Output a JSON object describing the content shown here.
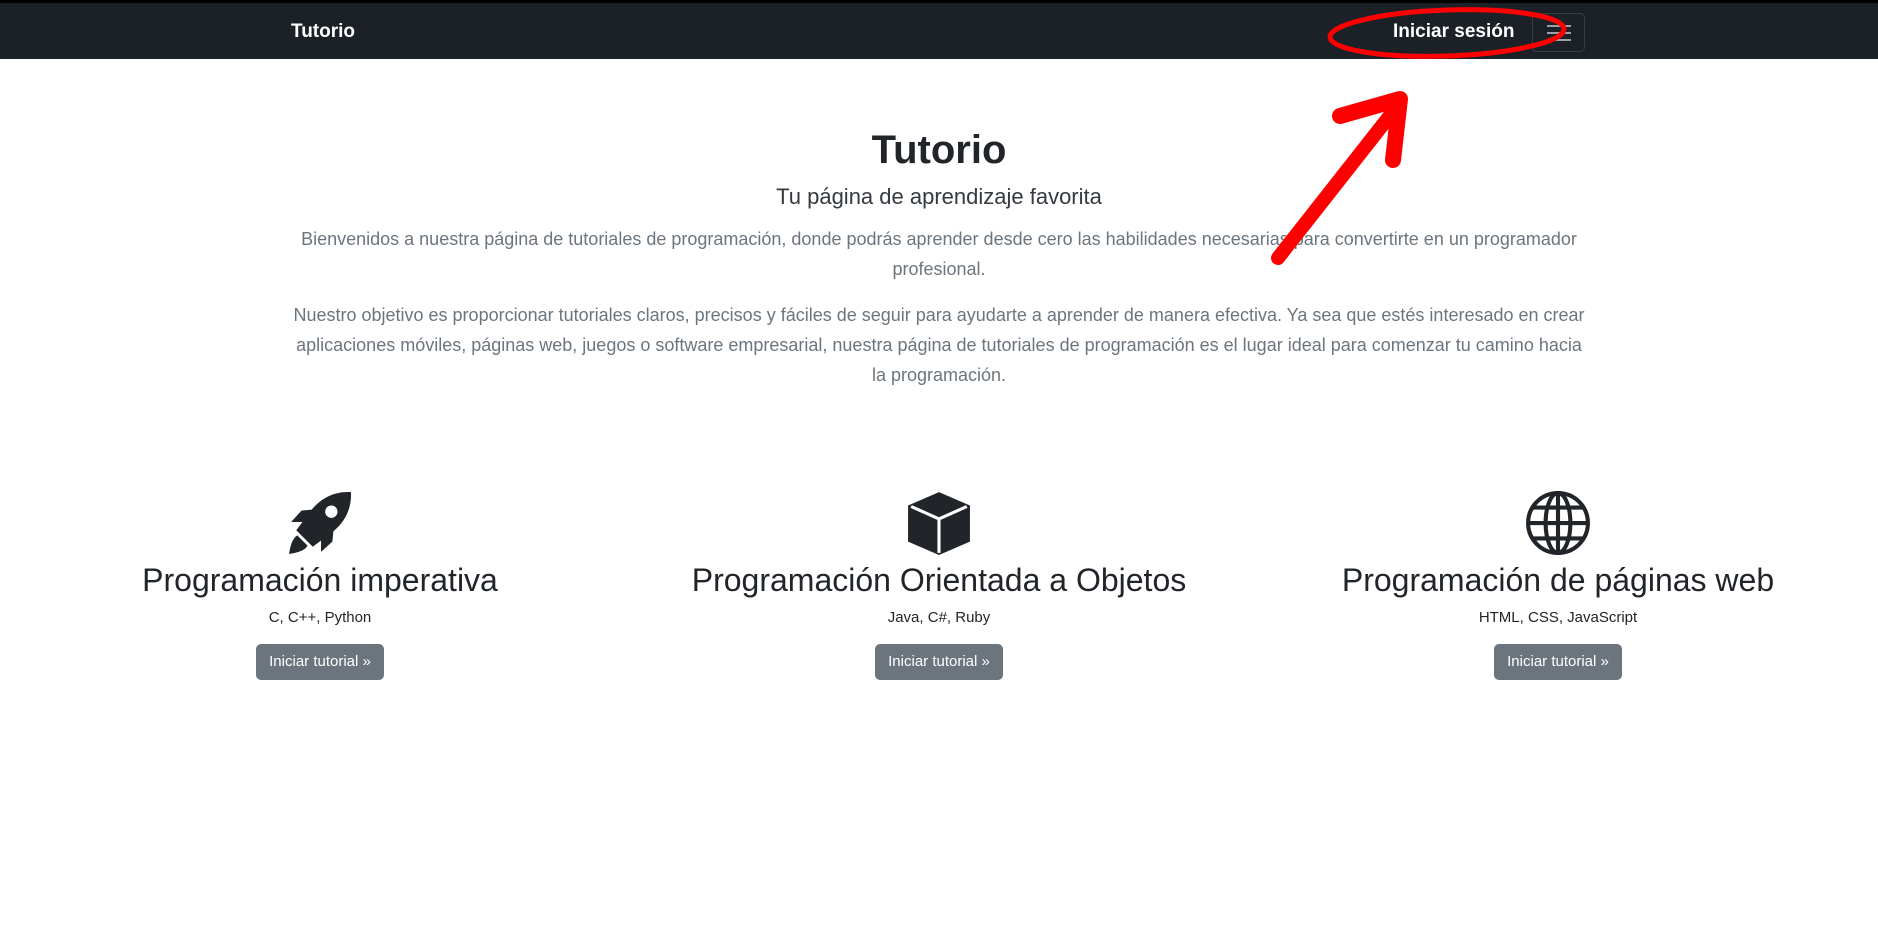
{
  "navbar": {
    "brand": "Tutorio",
    "login_label": "Iniciar sesión",
    "toggler_icon": "hamburger-icon",
    "background": "#1c2027"
  },
  "hero": {
    "title": "Tutorio",
    "subtitle": "Tu página de aprendizaje favorita",
    "paragraphs": [
      "Bienvenidos a nuestra página de tutoriales de programación, donde podrás aprender desde cero las habilidades necesarias para convertirte en un programador profesional.",
      "Nuestro objetivo es proporcionar tutoriales claros, precisos y fáciles de seguir para ayudarte a aprender de manera efectiva. Ya sea que estés interesado en crear aplicaciones móviles, páginas web, juegos o software empresarial, nuestra página de tutoriales de programación es el lugar ideal para comenzar tu camino hacia la programación."
    ]
  },
  "features": [
    {
      "icon": "rocket-icon",
      "title": "Programación imperativa",
      "languages": "C, C++, Python",
      "button_label": "Iniciar tutorial »"
    },
    {
      "icon": "box-icon",
      "title": "Programación Orientada a Objetos",
      "languages": "Java, C#, Ruby",
      "button_label": "Iniciar tutorial »"
    },
    {
      "icon": "globe-icon",
      "title": "Programación de páginas web",
      "languages": "HTML, CSS, JavaScript",
      "button_label": "Iniciar tutorial »"
    }
  ],
  "annotation": {
    "color": "#ff0000",
    "shapes": [
      "highlight-ellipse",
      "pointer-arrow"
    ]
  },
  "colors": {
    "button": "#6c757d",
    "muted_text": "#6c757d",
    "text": "#212529"
  }
}
